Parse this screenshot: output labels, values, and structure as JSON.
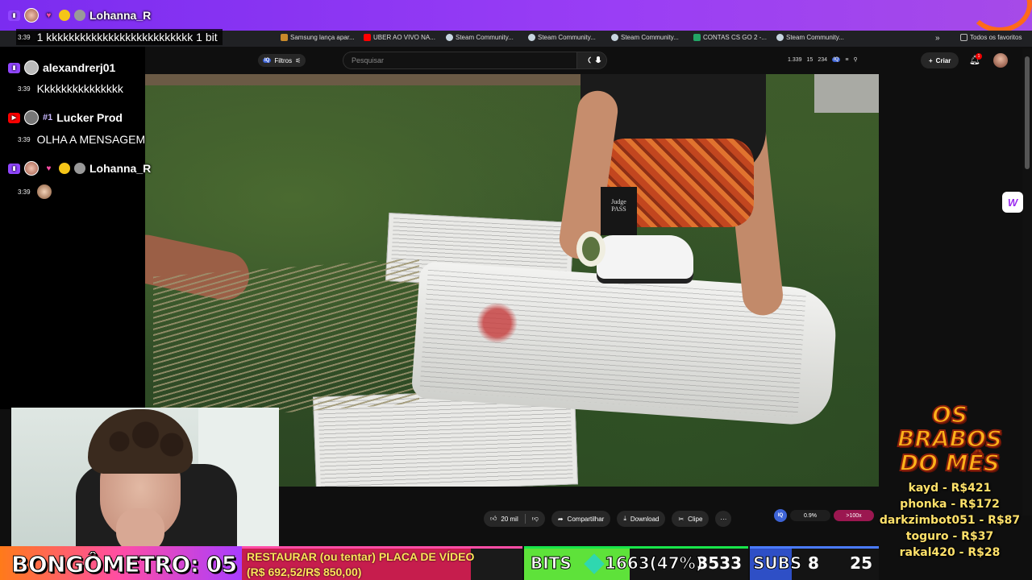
{
  "colors": {
    "topbar": "#8a35f2",
    "twitch": "#9146ff",
    "youtube": "#ff0000",
    "goal_text": "#ffe45a",
    "bits_green": "#5ee23a",
    "subs_blue": "#2e4fc6",
    "donor_text": "#ffe16a"
  },
  "bookmarks": {
    "items": [
      {
        "label": "Samsung lança apar...",
        "icon": "bookmark-icon"
      },
      {
        "label": "UBER AO VIVO NA...",
        "icon": "youtube-icon"
      },
      {
        "label": "Steam Community...",
        "icon": "steam-icon"
      },
      {
        "label": "Steam Community...",
        "icon": "steam-icon"
      },
      {
        "label": "Steam Community...",
        "icon": "steam-icon"
      },
      {
        "label": "CONTAS CS GO 2 -...",
        "icon": "sheets-icon"
      },
      {
        "label": "Steam Community...",
        "icon": "steam-icon"
      }
    ],
    "more": "»",
    "all_favorites": "Todos os favoritos"
  },
  "youtube": {
    "filters_label": "Filtros",
    "search_placeholder": "Pesquisar",
    "stats": {
      "a": "1.339",
      "b": "15",
      "c": "234"
    },
    "create_label": "Criar",
    "notif_count": "1",
    "like_count": "20 mil",
    "share_label": "Compartilhar",
    "download_label": "Download",
    "clip_label": "Clipe",
    "more_label": "···",
    "ext_pct": "0.9%",
    "ext_hot": ">100x"
  },
  "chat": {
    "messages": [
      {
        "platform": "twitch",
        "user": "Lohanna_R",
        "time": "3:39",
        "text": "1 kkkkkkkkkkkkkkkkkkkkkkkkkk 1 bit"
      },
      {
        "platform": "twitch",
        "user": "alexandrerj01",
        "time": "3:39",
        "text": "Kkkkkkkkkkkkkkk"
      },
      {
        "platform": "youtube",
        "user": "Lucker Prod",
        "badge": "#1",
        "time": "3:39",
        "text": "OLHA A MENSAGEM"
      },
      {
        "platform": "twitch",
        "user": "Lohanna_R",
        "time": "3:39",
        "text": ""
      }
    ]
  },
  "brabos": {
    "title_line1": "OS",
    "title_line2": "BRABOS",
    "title_line3": "DO MÊS",
    "donors": [
      "kayd - R$421",
      "phonka - R$172",
      "darkzimbot051 - R$87",
      "toguro - R$37",
      "rakal420 - R$28"
    ]
  },
  "overlay": {
    "bongometro": "BONGÔMETRO: 05",
    "goal_line1": "RESTAURAR (ou tentar) PLACA DE VÍDEO",
    "goal_line2": "(R$ 692,52/R$ 850,00)",
    "goal_fraction": 0.815,
    "bits_label": "BITS",
    "bits_progress": "1663(47%)",
    "bits_goal": "3533",
    "bits_fraction": 0.47,
    "subs_label": "SUBS",
    "subs_current": "8",
    "subs_goal": "25"
  }
}
